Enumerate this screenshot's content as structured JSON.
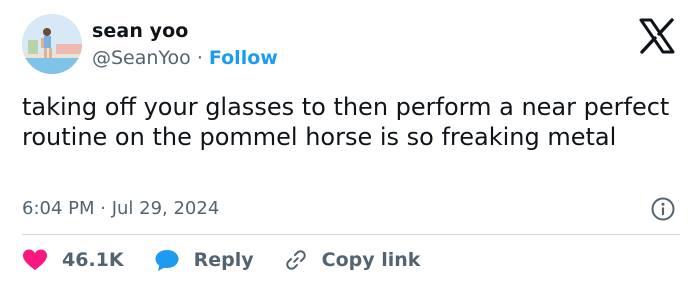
{
  "author": {
    "display_name": "sean yoo",
    "handle": "@SeanYoo",
    "separator": "·",
    "follow_label": "Follow"
  },
  "tweet": {
    "text": "taking off your glasses to then perform a near perfect routine on the pommel horse is so freaking metal",
    "timestamp": "6:04 PM · Jul 29, 2024"
  },
  "actions": {
    "like_count": "46.1K",
    "reply_label": "Reply",
    "copy_link_label": "Copy link"
  },
  "colors": {
    "text": "#0f1419",
    "secondary": "#536471",
    "link": "#1d9bf0",
    "like": "#f91880",
    "divider": "#cfd9de"
  },
  "icons": [
    "x-logo-icon",
    "info-icon",
    "heart-icon",
    "reply-bubble-icon",
    "link-icon"
  ]
}
